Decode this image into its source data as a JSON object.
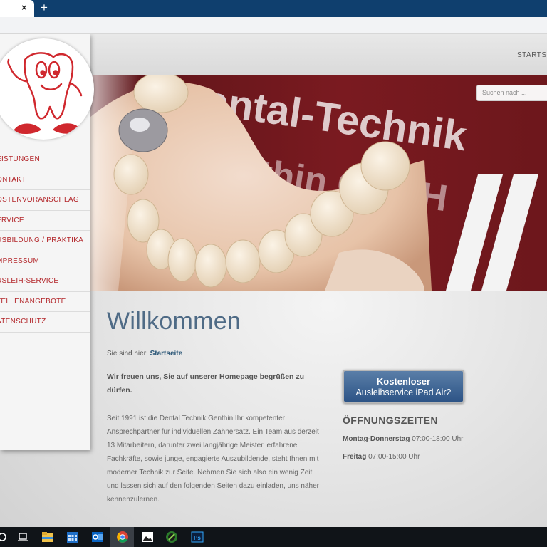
{
  "browser": {
    "tab_close": "×",
    "new_tab": "+"
  },
  "topnav": {
    "home_link": "STARTSE"
  },
  "sidebar": {
    "items": [
      {
        "label": "EISTUNGEN"
      },
      {
        "label": "ONTAKT"
      },
      {
        "label": "OSTENVORANSCHLAG"
      },
      {
        "label": "ERVICE"
      },
      {
        "label": "USBILDUNG / PRAKTIKA"
      },
      {
        "label": "MPRESSUM"
      },
      {
        "label": "USLEIH-SERVICE"
      },
      {
        "label": "TELLENANGEBOTE"
      },
      {
        "label": "ATENSCHUTZ"
      }
    ]
  },
  "search": {
    "placeholder": "Suchen nach ..."
  },
  "hero": {
    "banner_text_1": "ental-Technik",
    "banner_text_2": "nthin GmbH"
  },
  "main": {
    "title": "Willkommen",
    "breadcrumb_prefix": "Sie sind hier:",
    "breadcrumb_link": "Startseite",
    "intro": "Wir freuen uns, Sie auf unserer Homepage begrüßen zu dürfen.",
    "body": "Seit 1991 ist die Dental Technik Genthin Ihr kompetenter Ansprechpartner für individuellen Zahnersatz. Ein Team aus derzeit 13 Mitarbeitern, darunter zwei langjährige Meister, erfahrene Fachkräfte, sowie junge, engagierte Auszubildende, steht Ihnen mit moderner Technik zur Seite. Nehmen Sie sich also ein wenig Zeit und lassen sich auf den folgenden Seiten dazu einladen, uns näher kennenzulernen."
  },
  "promo": {
    "line1": "Kostenloser",
    "line2": "Ausleihservice iPad Air2"
  },
  "hours": {
    "heading": "ÖFFNUNGSZEITEN",
    "rows": [
      {
        "days": "Montag-Donnerstag",
        "time": "07:00-18:00 Uhr"
      },
      {
        "days": "Freitag",
        "time": "07:00-15:00 Uhr"
      }
    ]
  },
  "colors": {
    "brand_red": "#b3262a",
    "heading_blue": "#4f6b86",
    "tabbar": "#0f3f6e"
  },
  "taskbar": {
    "icons": [
      "search-icon",
      "task-view-icon",
      "file-explorer-icon",
      "calendar-icon",
      "outlook-icon",
      "chrome-icon",
      "photos-icon",
      "globe-icon",
      "photoshop-icon"
    ]
  }
}
